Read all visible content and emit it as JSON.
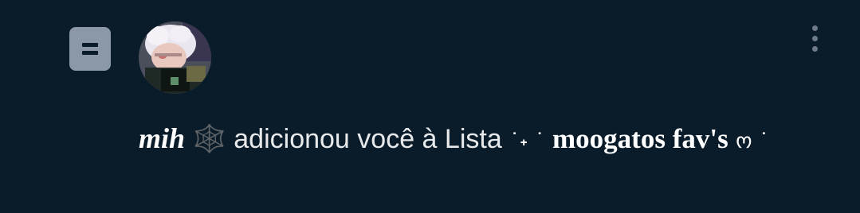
{
  "notification": {
    "type_icon": "list-icon",
    "avatar": "user-avatar",
    "more_icon": "more-vertical-icon",
    "actor_name": "mih",
    "actor_emoji": "🕸️",
    "action_text": " adicionou você à Lista ",
    "list_prefix": "˙˖ ˙",
    "list_name": "moogatos fav's",
    "list_suffix": "ო ˙"
  }
}
